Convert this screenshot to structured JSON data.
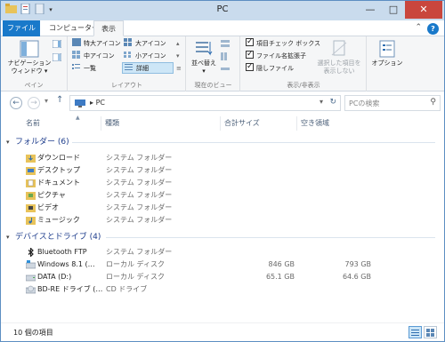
{
  "window": {
    "title": "PC",
    "buttons": {
      "minimize": "—",
      "maximize": "□",
      "close": "✕"
    }
  },
  "tabs": {
    "file": "ファイル",
    "computer": "コンピューター",
    "view": "表示"
  },
  "ribbon": {
    "pane_group": {
      "nav_pane_label_line1": "ナビゲーション",
      "nav_pane_label_line2": "ウィンドウ ▾",
      "group_label": "ペイン"
    },
    "layout_group": {
      "extra_large": "特大アイコン",
      "large": "大アイコン",
      "medium": "中アイコン",
      "small": "小アイコン",
      "list": "一覧",
      "details": "詳細",
      "group_label": "レイアウト"
    },
    "current_view_group": {
      "sort_label_line1": "並べ替え",
      "sort_label_line2": "▾",
      "group_label": "現在のビュー"
    },
    "show_hide_group": {
      "item_checkboxes": "項目チェック ボックス",
      "file_extensions": "ファイル名拡張子",
      "hidden_items": "隠しファイル",
      "hide_selected_line1": "選択した項目を",
      "hide_selected_line2": "表示しない",
      "group_label": "表示/非表示"
    },
    "options_group": {
      "options_label": "オプション"
    }
  },
  "address": {
    "crumb": "PC",
    "search_placeholder": "PCの検索"
  },
  "columns": {
    "name": "名前",
    "type": "種類",
    "total_size": "合計サイズ",
    "free_space": "空き領域"
  },
  "sections": {
    "folders": "フォルダー (6)",
    "devices": "デバイスとドライブ (4)"
  },
  "folders": [
    {
      "name": "ダウンロード",
      "type": "システム フォルダー",
      "icon": "downloads-folder-icon"
    },
    {
      "name": "デスクトップ",
      "type": "システム フォルダー",
      "icon": "desktop-folder-icon"
    },
    {
      "name": "ドキュメント",
      "type": "システム フォルダー",
      "icon": "documents-folder-icon"
    },
    {
      "name": "ピクチャ",
      "type": "システム フォルダー",
      "icon": "pictures-folder-icon"
    },
    {
      "name": "ビデオ",
      "type": "システム フォルダー",
      "icon": "videos-folder-icon"
    },
    {
      "name": "ミュージック",
      "type": "システム フォルダー",
      "icon": "music-folder-icon"
    }
  ],
  "devices": [
    {
      "name": "Bluetooth FTP",
      "type": "システム フォルダー",
      "total": "",
      "free": "",
      "icon": "bluetooth-icon"
    },
    {
      "name": "Windows 8.1 (…",
      "type": "ローカル ディスク",
      "total": "846 GB",
      "free": "793 GB",
      "icon": "windows-drive-icon"
    },
    {
      "name": "DATA (D:)",
      "type": "ローカル ディスク",
      "total": "65.1 GB",
      "free": "64.6 GB",
      "icon": "hard-drive-icon"
    },
    {
      "name": "BD-RE ドライブ (…",
      "type": "CD ドライブ",
      "total": "",
      "free": "",
      "icon": "optical-drive-icon"
    }
  ],
  "status": {
    "item_count": "10 個の項目"
  }
}
